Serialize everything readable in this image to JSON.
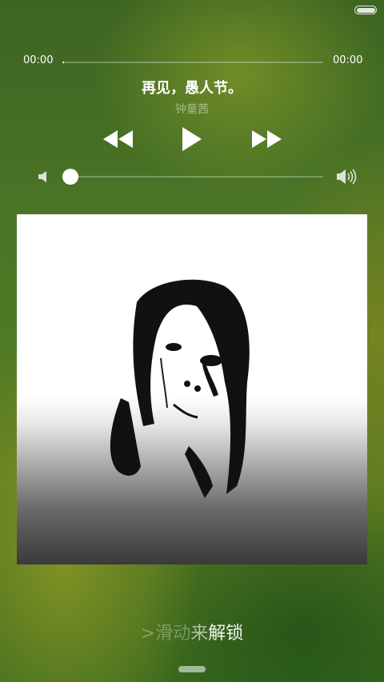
{
  "status_bar": {
    "battery_icon": "battery-full-icon",
    "battery_level": 1.0
  },
  "player": {
    "elapsed": "00:00",
    "duration": "00:00",
    "progress_fraction": 0.0,
    "title": "再见，愚人节。",
    "artist": "钟童茜",
    "controls": {
      "prev_icon": "rewind-icon",
      "play_icon": "play-icon",
      "next_icon": "fast-forward-icon"
    },
    "volume": {
      "low_icon": "volume-low-icon",
      "high_icon": "volume-high-icon",
      "level_fraction": 0.0
    }
  },
  "album_art": {
    "description_icon": "album-cover-image"
  },
  "unlock": {
    "part1": ">滑动",
    "part2": "来",
    "part3": "解锁"
  },
  "colors": {
    "accent": "#ffffff",
    "background": "#4a7426"
  }
}
